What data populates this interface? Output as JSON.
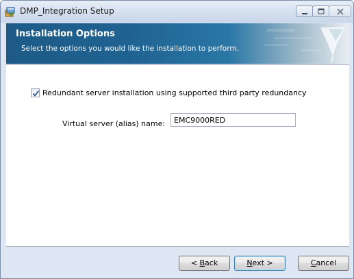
{
  "window": {
    "title": "DMP_Integration Setup"
  },
  "banner": {
    "title": "Installation Options",
    "subtitle": "Select the options you would like the installation to perform."
  },
  "options": {
    "redundant_checkbox_label": "Redundant server installation using supported third party redundancy",
    "redundant_checked": true,
    "virtual_server_label": "Virtual server (alias) name:",
    "virtual_server_value": "EMC9000RED"
  },
  "buttons": {
    "back_prefix": "< ",
    "back_mnemonic": "B",
    "back_rest": "ack",
    "next_mnemonic": "N",
    "next_rest": "ext >",
    "cancel_mnemonic": "C",
    "cancel_rest": "ancel"
  },
  "icons": {
    "app": "installer-icon",
    "minimize": "minimize-icon",
    "maximize": "maximize-icon",
    "close": "close-icon",
    "check": "checkmark-icon"
  },
  "colors": {
    "banner_dark": "#1d5a87",
    "window_frame": "#dde6f2",
    "check_mark": "#2a4f93"
  }
}
